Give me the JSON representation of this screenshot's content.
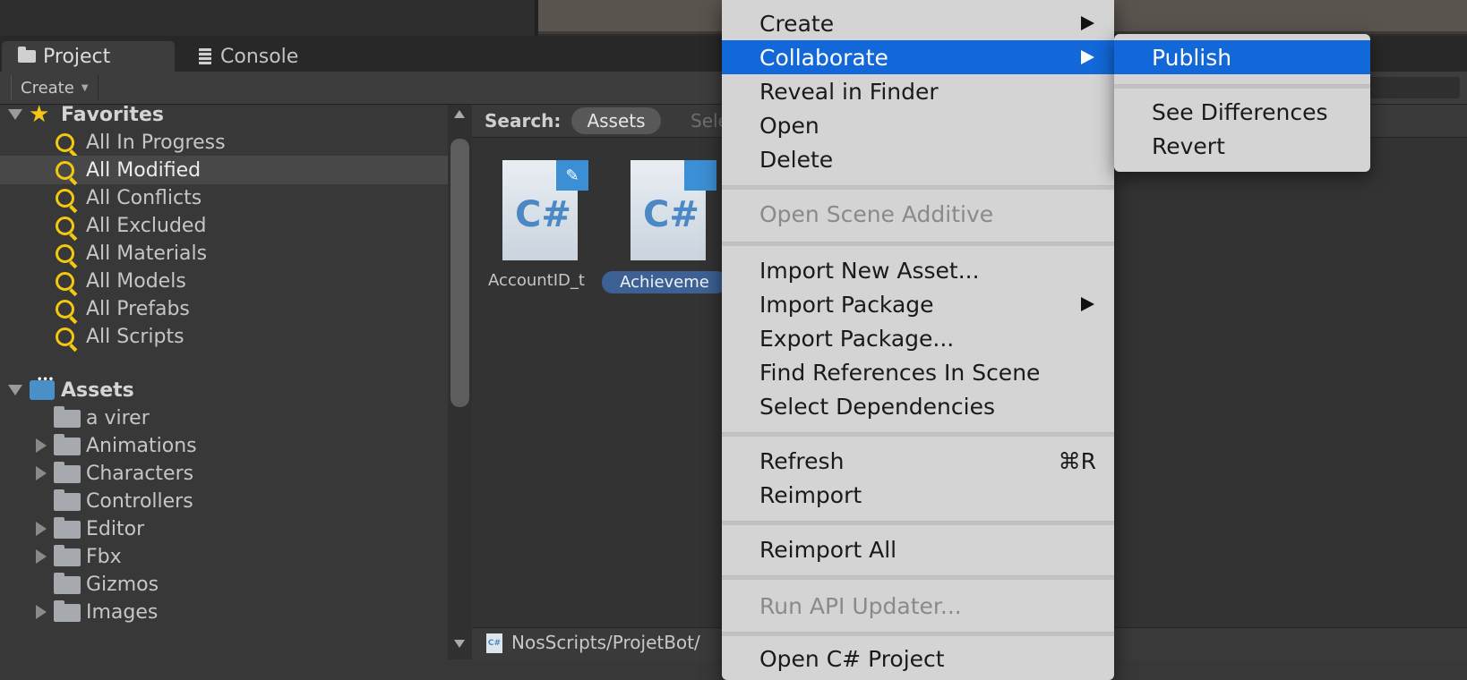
{
  "tabs": [
    {
      "label": "Project",
      "icon": "folder-icon",
      "active": true
    },
    {
      "label": "Console",
      "icon": "console-icon",
      "active": false
    }
  ],
  "toolbar": {
    "create_label": "Create"
  },
  "favorites": {
    "header": "Favorites",
    "items": [
      "All In Progress",
      "All Modified",
      "All Conflicts",
      "All Excluded",
      "All Materials",
      "All Models",
      "All Prefabs",
      "All Scripts"
    ],
    "selected": "All Modified"
  },
  "assets": {
    "header": "Assets",
    "folders": [
      {
        "name": "a virer",
        "expandable": false
      },
      {
        "name": "Animations",
        "expandable": true
      },
      {
        "name": "Characters",
        "expandable": true
      },
      {
        "name": "Controllers",
        "expandable": false
      },
      {
        "name": "Editor",
        "expandable": true
      },
      {
        "name": "Fbx",
        "expandable": true
      },
      {
        "name": "Gizmos",
        "expandable": false
      },
      {
        "name": "Images",
        "expandable": true
      }
    ]
  },
  "search": {
    "label": "Search:",
    "scope_selected": "Assets",
    "scope_other": "Sele"
  },
  "asset_grid": [
    {
      "name": "AccountID_t",
      "glyph": "C#",
      "badge": "✎"
    },
    {
      "name": "Achieveme",
      "glyph": "C#",
      "badge": ""
    }
  ],
  "bottom_path": "NosScripts/ProjetBot/",
  "context_menu": {
    "items": [
      {
        "label": "Create",
        "submenu": true
      },
      {
        "label": "Collaborate",
        "submenu": true,
        "highlighted": true
      },
      {
        "label": "Reveal in Finder"
      },
      {
        "label": "Open"
      },
      {
        "label": "Delete"
      },
      {
        "label": "Open Scene Additive",
        "disabled": true
      },
      {
        "label": "Import New Asset..."
      },
      {
        "label": "Import Package",
        "submenu": true
      },
      {
        "label": "Export Package..."
      },
      {
        "label": "Find References In Scene"
      },
      {
        "label": "Select Dependencies"
      },
      {
        "label": "Refresh",
        "shortcut": "⌘R"
      },
      {
        "label": "Reimport"
      },
      {
        "label": "Reimport All"
      },
      {
        "label": "Run API Updater...",
        "disabled": true
      },
      {
        "label": "Open C# Project"
      }
    ]
  },
  "submenu": {
    "items": [
      {
        "label": "Publish",
        "highlighted": true
      },
      {
        "label": "See Differences"
      },
      {
        "label": "Revert"
      }
    ]
  },
  "colors": {
    "highlight": "#1268d8",
    "menu_bg": "#d4d4d4",
    "panel_bg": "#383838",
    "favorite_icon": "#f2c811"
  }
}
